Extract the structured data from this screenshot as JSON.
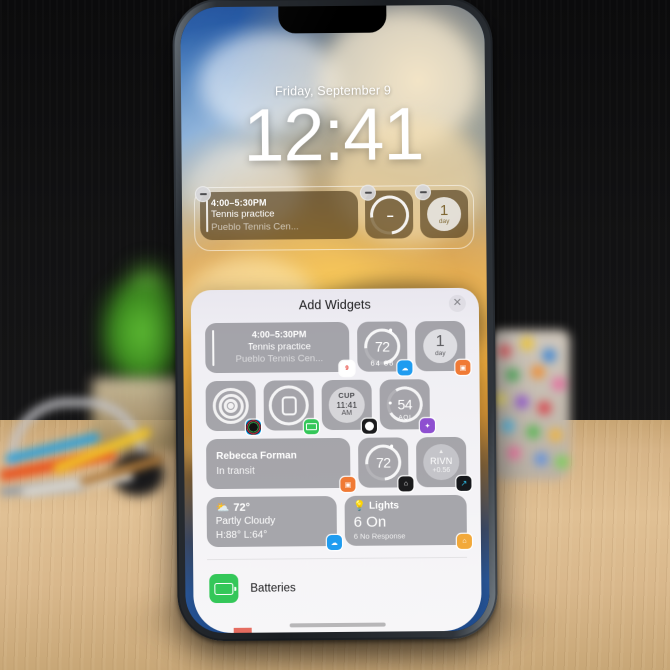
{
  "scene": {
    "description": "iPhone on wooden desk showing lock screen widget editing"
  },
  "lock_screen": {
    "date": "Friday, September 9",
    "time": "12:41",
    "widgets": [
      {
        "type": "calendar",
        "time_range": "4:00–5:30PM",
        "title": "Tennis practice",
        "location": "Pueblo Tennis Cen..."
      },
      {
        "type": "ring",
        "value": "--"
      },
      {
        "type": "countdown",
        "number": "1",
        "unit": "day"
      }
    ],
    "remove_icon": "minus-icon"
  },
  "sheet": {
    "title": "Add Widgets",
    "close_icon": "close-icon",
    "rows": [
      {
        "widgets": [
          {
            "kind": "calendar-wide",
            "name": "calendar-widget",
            "time_range": "4:00–5:30PM",
            "title": "Tennis practice",
            "location": "Pueblo Tennis Cen...",
            "badge_icon": "calendar-app-icon",
            "badge_color": "#ffffff"
          },
          {
            "kind": "weather-ring",
            "name": "weather-temp-widget",
            "value": "72",
            "sub": "64  88",
            "badge_icon": "weather-app-icon",
            "badge_color": "#1f9cf0"
          },
          {
            "kind": "countdown",
            "name": "countdown-widget",
            "number": "1",
            "unit": "day",
            "badge_icon": "countdown-app-icon",
            "badge_color": "#f07a35"
          }
        ]
      },
      {
        "widgets": [
          {
            "kind": "fitness-rings",
            "name": "fitness-widget",
            "badge_icon": "fitness-app-icon",
            "badge_color": "#111111"
          },
          {
            "kind": "watch-battery",
            "name": "watch-battery-widget",
            "badge_icon": "batteries-app-icon",
            "badge_color": "#34c759"
          },
          {
            "kind": "world-clock",
            "name": "world-clock-widget",
            "city": "CUP",
            "time": "11:41",
            "period": "AM",
            "badge_icon": "clock-app-icon",
            "badge_color": "#1b1b1d"
          },
          {
            "kind": "air-quality",
            "name": "air-quality-widget",
            "value": "54",
            "label": "AQI",
            "badge_icon": "airquality-app-icon",
            "badge_color": "#8e4fd0"
          }
        ]
      },
      {
        "widgets": [
          {
            "kind": "findmy-wide",
            "name": "find-my-widget",
            "person": "Rebecca Forman",
            "status": "In transit",
            "badge_icon": "findmy-app-icon",
            "badge_color": "#f07a35"
          },
          {
            "kind": "home-temp",
            "name": "home-temperature-widget",
            "value": "72",
            "badge_icon": "home-app-icon",
            "badge_color": "#1b1b1d"
          },
          {
            "kind": "stocks",
            "name": "stocks-widget",
            "symbol": "RIVN",
            "change": "+0.56",
            "trend_icon": "triangle-up-icon",
            "badge_icon": "stocks-app-icon",
            "badge_color": "#16181c"
          }
        ]
      },
      {
        "widgets": [
          {
            "kind": "weather-wide",
            "name": "weather-conditions-widget",
            "temp": "72°",
            "condition": "Partly Cloudy",
            "high_low": "H:88° L:64°",
            "condition_icon": "partly-cloudy-icon",
            "badge_icon": "weather-app-icon",
            "badge_color": "#1f9cf0"
          },
          {
            "kind": "lights-wide",
            "name": "lights-widget",
            "label": "Lights",
            "count": "6 On",
            "status": "6 No Response",
            "label_icon": "lightbulb-icon",
            "badge_icon": "home-app-icon",
            "badge_color": "#f2a93b"
          }
        ]
      }
    ],
    "list": [
      {
        "name": "batteries",
        "label": "Batteries",
        "icon": "battery-icon",
        "icon_color": "#34c759"
      }
    ]
  }
}
